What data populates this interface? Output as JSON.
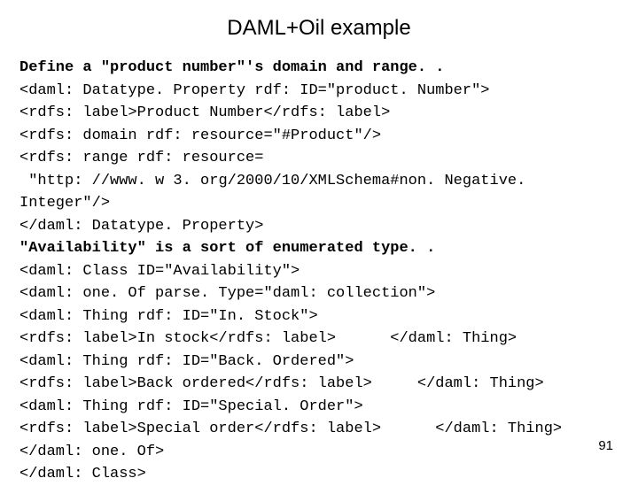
{
  "title": "DAML+Oil example",
  "heading1": "Define a \"product number\"'s domain and range. .",
  "lines1": [
    "<daml: Datatype. Property rdf: ID=\"product. Number\">",
    "<rdfs: label>Product Number</rdfs: label>",
    "<rdfs: domain rdf: resource=\"#Product\"/>",
    "<rdfs: range rdf: resource=",
    " \"http: //www. w 3. org/2000/10/XMLSchema#non. Negative. Integer\"/>",
    "</daml: Datatype. Property>"
  ],
  "heading2": "\"Availability\" is a sort of enumerated type. .",
  "lines2": [
    "<daml: Class ID=\"Availability\">",
    "<daml: one. Of parse. Type=\"daml: collection\">",
    "<daml: Thing rdf: ID=\"In. Stock\">",
    "<rdfs: label>In stock</rdfs: label>      </daml: Thing>",
    "<daml: Thing rdf: ID=\"Back. Ordered\">",
    "<rdfs: label>Back ordered</rdfs: label>     </daml: Thing>",
    "<daml: Thing rdf: ID=\"Special. Order\">",
    "<rdfs: label>Special order</rdfs: label>      </daml: Thing>",
    "</daml: one. Of>",
    "</daml: Class>"
  ],
  "pagenum": "91"
}
